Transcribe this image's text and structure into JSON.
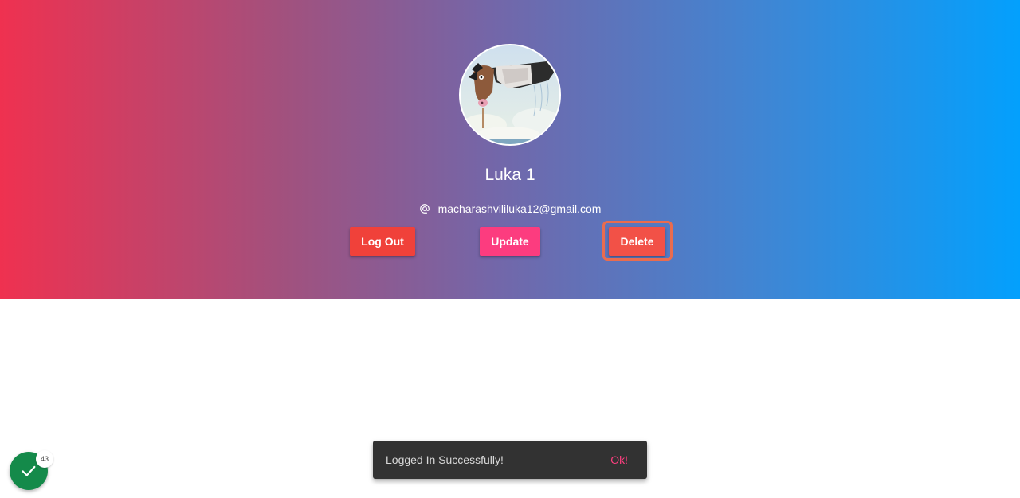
{
  "profile": {
    "name": "Luka 1",
    "email": "macharashvililuka12@gmail.com",
    "avatar_alt": "profile-avatar"
  },
  "actions": {
    "logout_label": "Log Out",
    "update_label": "Update",
    "delete_label": "Delete"
  },
  "snackbar": {
    "message": "Logged In Successfully!",
    "action_label": "Ok!"
  },
  "status_badge": {
    "count": "43"
  },
  "colors": {
    "logout": "#f0413a",
    "update": "#fc3c7f",
    "delete": "#f25147",
    "snackbar_action": "#ff3f80",
    "status_fab": "#148a4a"
  },
  "icons": {
    "email": "at-icon",
    "status": "check-icon"
  }
}
